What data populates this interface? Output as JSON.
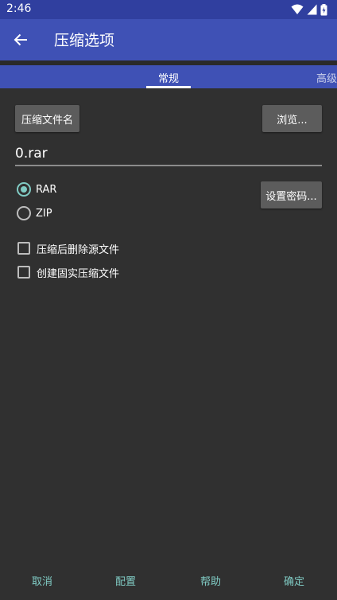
{
  "status_bar": {
    "time": "2:46",
    "icons": [
      "wifi-icon",
      "signal-icon",
      "battery-icon"
    ]
  },
  "app_bar": {
    "title": "压缩选项",
    "back_icon": "arrow-left-icon"
  },
  "tabs": [
    {
      "label": "常规",
      "selected": true
    },
    {
      "label": "高级",
      "selected": false
    }
  ],
  "general": {
    "archive_name_button": "压缩文件名",
    "browse_button": "浏览...",
    "filename_value": "0.rar",
    "formats": [
      {
        "label": "RAR",
        "checked": true
      },
      {
        "label": "ZIP",
        "checked": false
      }
    ],
    "set_password_button": "设置密码...",
    "options": [
      {
        "label": "压缩后删除源文件",
        "checked": false
      },
      {
        "label": "创建固实压缩文件",
        "checked": false
      }
    ]
  },
  "bottom_actions": {
    "cancel": "取消",
    "config": "配置",
    "help": "帮助",
    "ok": "确定"
  },
  "colors": {
    "primary": "#3f51b5",
    "primary_dark": "#303f9f",
    "accent": "#80cbc4",
    "background": "#303030",
    "button": "#5c5c5c"
  }
}
